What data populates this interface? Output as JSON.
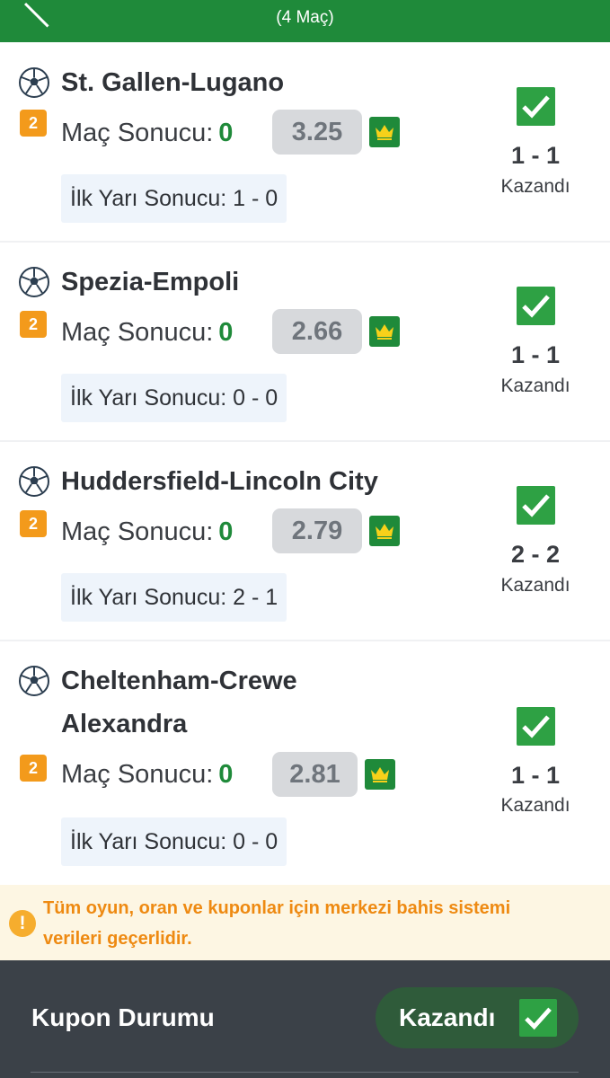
{
  "header": {
    "subtitle": "(4 Maç)"
  },
  "matches": [
    {
      "teams": "St. Gallen-Lugano",
      "badge": "2",
      "market_label": "Maç Sonucu:",
      "selection": "0",
      "odds": "3.25",
      "half_time": "İlk Yarı Sonucu: 1 - 0",
      "score": "1 - 1",
      "status": "Kazandı"
    },
    {
      "teams": "Spezia-Empoli",
      "badge": "2",
      "market_label": "Maç Sonucu:",
      "selection": "0",
      "odds": "2.66",
      "half_time": "İlk Yarı Sonucu: 0 - 0",
      "score": "1 - 1",
      "status": "Kazandı"
    },
    {
      "teams": "Huddersfield-Lincoln City",
      "badge": "2",
      "market_label": "Maç Sonucu:",
      "selection": "0",
      "odds": "2.79",
      "half_time": "İlk Yarı Sonucu: 2 - 1",
      "score": "2 - 2",
      "status": "Kazandı"
    },
    {
      "teams": "Cheltenham-Crewe Alexandra",
      "badge": "2",
      "market_label": "Maç Sonucu:",
      "selection": "0",
      "odds": "2.81",
      "half_time": "İlk Yarı Sonucu: 0 - 0",
      "score": "1 - 1",
      "status": "Kazandı"
    }
  ],
  "notice": {
    "icon": "!",
    "text": "Tüm oyun, oran ve kuponlar için merkezi bahis sistemi verileri geçerlidir."
  },
  "footer": {
    "title": "Kupon Durumu",
    "status": "Kazandı"
  },
  "colors": {
    "brand_green": "#1f8a3a",
    "check_green": "#2ea144",
    "badge_orange": "#f39a1b",
    "notice_text": "#ee8a12",
    "footer_bg": "#3b4148"
  },
  "icons": {
    "back": "back-arrow-icon",
    "ball": "soccer-ball-icon",
    "crown": "crown-icon",
    "check": "checkmark-icon",
    "warning": "warning-icon"
  }
}
